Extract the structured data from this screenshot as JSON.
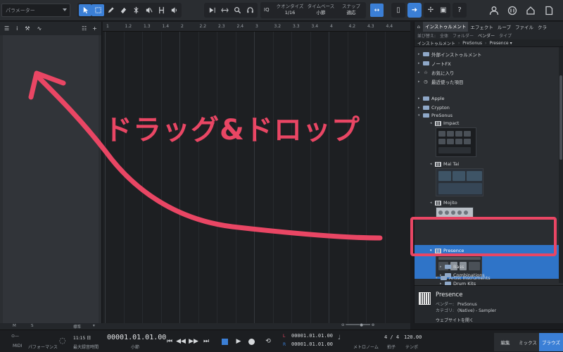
{
  "toolbar": {
    "parameter_label": "パラメーター",
    "quantize": {
      "iq_label": "IQ",
      "label": "クオンタイズ",
      "value": "1/16"
    },
    "timebase": {
      "label": "タイムベース",
      "value": "小節"
    },
    "snap": {
      "label": "スナップ",
      "value": "適応"
    }
  },
  "ruler": {
    "ticks": [
      "1",
      "1.2",
      "1.3",
      "1.4",
      "2",
      "2.2",
      "2.3",
      "2.4",
      "3",
      "3.2",
      "3.3",
      "3.4",
      "4",
      "4.2",
      "4.3",
      "4.4"
    ]
  },
  "browser": {
    "tabs": [
      "インストゥルメント",
      "エフェクト",
      "ループ",
      "ファイル",
      "クラ"
    ],
    "sort_label": "並び替え:",
    "sort_options": [
      "全体",
      "フォルダー",
      "ベンダー",
      "タイプ"
    ],
    "breadcrumb": [
      "インストゥルメント",
      "PreSonus",
      "Presence"
    ],
    "tree": {
      "top_items": [
        "外部インストゥルメント",
        "ノートFX",
        "お気に入り",
        "最近使った項目"
      ],
      "vendors": [
        "Apple",
        "Crypton",
        "PreSonus"
      ],
      "instruments": [
        "Impact",
        "Mai Tai",
        "Mojito",
        "Presence"
      ],
      "subfolders": [
        "Bass",
        "Combinations",
        "Drum Kits"
      ]
    },
    "info": {
      "name": "Presence",
      "vendor_label": "ベンダー:",
      "vendor": "PreSonus",
      "category_label": "カテゴリ:",
      "category": "(Native) - Sampler",
      "website": "ウェブサイトを開く"
    }
  },
  "status": {
    "m": "M",
    "s": "S",
    "std": "標準"
  },
  "transport": {
    "midi": "MIDI",
    "performance": "パフォーマンス",
    "record_time": "11:15 日",
    "record_time_label": "最大録音時間",
    "position": "00001.01.01.00",
    "position_unit": "小節",
    "loop_start": "00001.01.01.00",
    "loop_end": "00001.01.01.00",
    "metronome": "メトロノーム",
    "time_sig": "4 / 4",
    "time_sig_label": "拍子",
    "tempo": "120.00",
    "tempo_label": "テンポ",
    "pages": [
      "編集",
      "ミックス",
      "ブラウズ"
    ]
  },
  "annotation": {
    "text": "ドラッグ&ドロップ",
    "color": "#e94664"
  },
  "colors": {
    "accent": "#3b7fd6",
    "selection": "#2f74c8",
    "annotation": "#e94664"
  }
}
